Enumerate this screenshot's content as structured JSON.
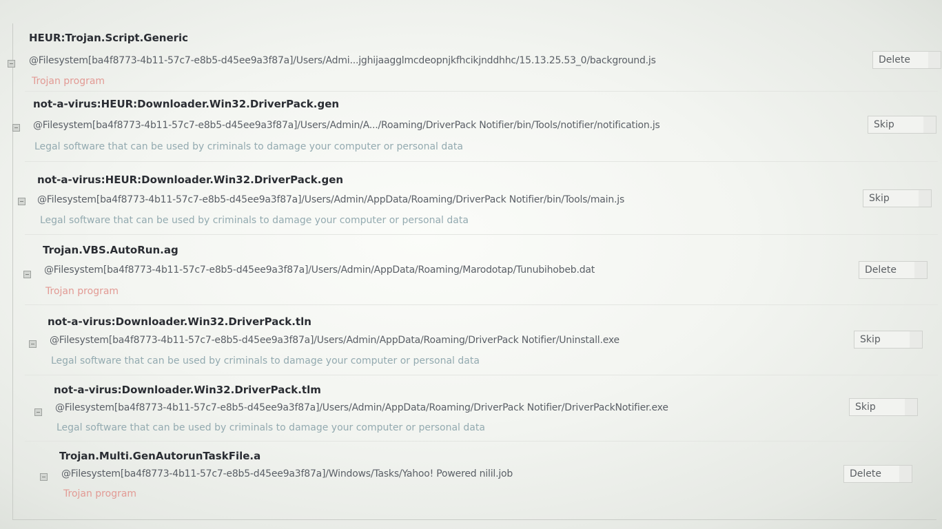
{
  "threats": [
    {
      "name": "HEUR:Trojan.Script.Generic",
      "path": "@Filesystem[ba4f8773-4b11-57c7-e8b5-d45ee9a3f87a]/Users/Admi...jghijaagglmcdeopnjkfhcikjnddhhc/15.13.25.53_0/background.js",
      "description": "Trojan program",
      "description_type": "trojan",
      "action": "Delete"
    },
    {
      "name": "not-a-virus:HEUR:Downloader.Win32.DriverPack.gen",
      "path": "@Filesystem[ba4f8773-4b11-57c7-e8b5-d45ee9a3f87a]/Users/Admin/A.../Roaming/DriverPack Notifier/bin/Tools/notifier/notification.js",
      "description": "Legal software that can be used by criminals to damage your computer or personal data",
      "description_type": "legal",
      "action": "Skip"
    },
    {
      "name": "not-a-virus:HEUR:Downloader.Win32.DriverPack.gen",
      "path": "@Filesystem[ba4f8773-4b11-57c7-e8b5-d45ee9a3f87a]/Users/Admin/AppData/Roaming/DriverPack Notifier/bin/Tools/main.js",
      "description": "Legal software that can be used by criminals to damage your computer or personal data",
      "description_type": "legal",
      "action": "Skip"
    },
    {
      "name": "Trojan.VBS.AutoRun.ag",
      "path": "@Filesystem[ba4f8773-4b11-57c7-e8b5-d45ee9a3f87a]/Users/Admin/AppData/Roaming/Marodotap/Tunubihobeb.dat",
      "description": "Trojan program",
      "description_type": "trojan",
      "action": "Delete"
    },
    {
      "name": "not-a-virus:Downloader.Win32.DriverPack.tln",
      "path": "@Filesystem[ba4f8773-4b11-57c7-e8b5-d45ee9a3f87a]/Users/Admin/AppData/Roaming/DriverPack Notifier/Uninstall.exe",
      "description": "Legal software that can be used by criminals to damage your computer or personal data",
      "description_type": "legal",
      "action": "Skip"
    },
    {
      "name": "not-a-virus:Downloader.Win32.DriverPack.tlm",
      "path": "@Filesystem[ba4f8773-4b11-57c7-e8b5-d45ee9a3f87a]/Users/Admin/AppData/Roaming/DriverPack Notifier/DriverPackNotifier.exe",
      "description": "Legal software that can be used by criminals to damage your computer or personal data",
      "description_type": "legal",
      "action": "Skip"
    },
    {
      "name": "Trojan.Multi.GenAutorunTaskFile.a",
      "path": "@Filesystem[ba4f8773-4b11-57c7-e8b5-d45ee9a3f87a]/Windows/Tasks/Yahoo! Powered nilil.job",
      "description": "Trojan program",
      "description_type": "trojan",
      "action": "Delete"
    }
  ],
  "colors": {
    "threat_name": "#2a2d33",
    "path": "#5a5f66",
    "legal_description": "#93aab0",
    "trojan_description": "#e29a94"
  }
}
